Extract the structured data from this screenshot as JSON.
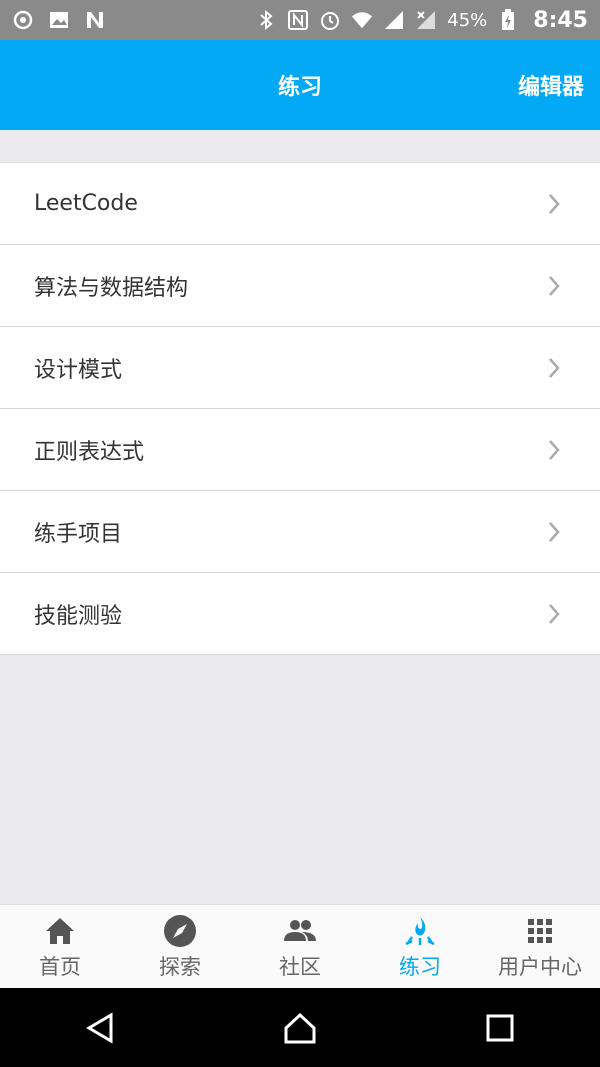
{
  "status_bar": {
    "battery": "45%",
    "time": "8:45",
    "icons": [
      "sync-icon",
      "image-icon",
      "n-app-icon",
      "bluetooth-icon",
      "nfc-icon",
      "alarm-icon",
      "wifi-icon",
      "signal-icon",
      "signal-x-icon",
      "battery-charging-icon"
    ]
  },
  "app_bar": {
    "title": "练习",
    "action": "编辑器",
    "background": "#03a9f4"
  },
  "list": {
    "items": [
      {
        "label": "LeetCode"
      },
      {
        "label": "算法与数据结构"
      },
      {
        "label": "设计模式"
      },
      {
        "label": "正则表达式"
      },
      {
        "label": "练手项目"
      },
      {
        "label": "技能测验"
      }
    ]
  },
  "bottom_nav": {
    "items": [
      {
        "label": "首页",
        "icon": "home-icon"
      },
      {
        "label": "探索",
        "icon": "compass-icon"
      },
      {
        "label": "社区",
        "icon": "people-icon"
      },
      {
        "label": "练习",
        "icon": "practice-icon",
        "active": true
      },
      {
        "label": "用户中心",
        "icon": "grid-icon"
      }
    ],
    "active_color": "#03a9f4"
  },
  "system_nav": {
    "buttons": [
      "back-icon",
      "home-circle-icon",
      "recents-icon"
    ]
  }
}
